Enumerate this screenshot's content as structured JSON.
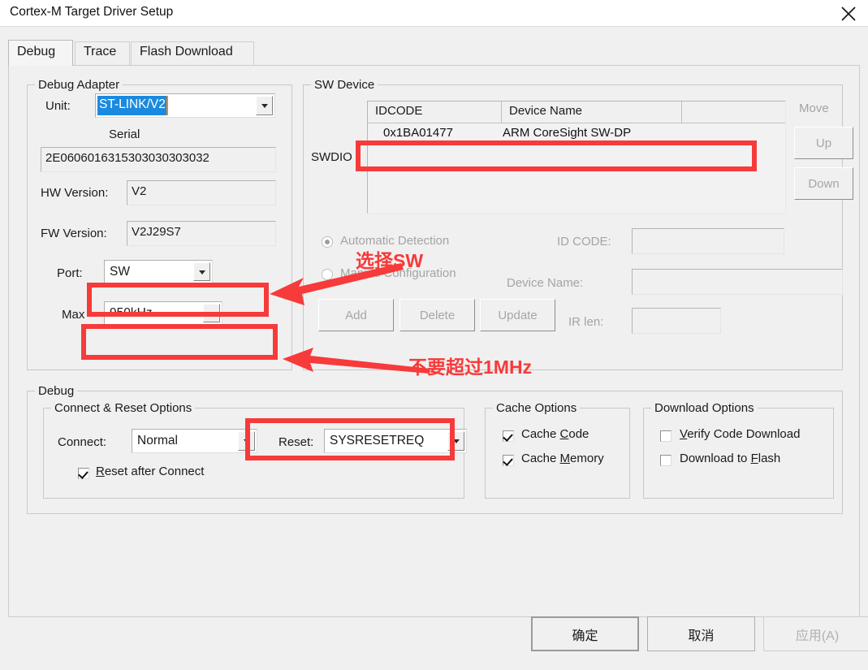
{
  "window": {
    "title": "Cortex-M Target Driver Setup",
    "close_icon": "close-icon"
  },
  "tabs": [
    {
      "label": "Debug",
      "active": true
    },
    {
      "label": "Trace",
      "active": false
    },
    {
      "label": "Flash Download",
      "active": false
    }
  ],
  "debug_adapter": {
    "legend": "Debug Adapter",
    "unit_label": "Unit:",
    "unit_value": "ST-LINK/V2",
    "serial_label": "Serial",
    "serial_value": "2E0606016315303030303032",
    "hw_version_label": "HW Version:",
    "hw_version_value": "V2",
    "fw_version_label": "FW Version:",
    "fw_version_value": "V2J29S7",
    "port_label": "Port:",
    "port_value": "SW",
    "max_label": "Max",
    "max_value": "950kHz"
  },
  "sw_device": {
    "legend": "SW Device",
    "swdio_label": "SWDIO",
    "columns": [
      "IDCODE",
      "Device Name",
      ""
    ],
    "rows": [
      {
        "idcode": "0x1BA01477",
        "device_name": "ARM CoreSight SW-DP"
      }
    ],
    "move_label": "Move",
    "up_label": "Up",
    "down_label": "Down",
    "auto_detection_label": "Automatic Detection",
    "manual_config_label": "Manual Configuration",
    "add_label": "Add",
    "delete_label": "Delete",
    "update_label": "Update",
    "id_code_label": "ID CODE:",
    "id_code_value": "",
    "device_name_label": "Device Name:",
    "device_name_value": "",
    "ir_len_label": "IR len:",
    "ir_len_value": ""
  },
  "debug": {
    "legend": "Debug",
    "connect_reset": {
      "legend": "Connect & Reset Options",
      "connect_label": "Connect:",
      "connect_value": "Normal",
      "reset_label": "Reset:",
      "reset_value": "SYSRESETREQ",
      "reset_after_connect_label": "Reset after Connect",
      "reset_after_connect_checked": true
    },
    "cache_options": {
      "legend": "Cache Options",
      "cache_code_label": "Cache Code",
      "cache_code_checked": true,
      "cache_memory_label": "Cache Memory",
      "cache_memory_checked": true
    },
    "download_options": {
      "legend": "Download Options",
      "verify_code_label": "Verify Code Download",
      "verify_code_checked": false,
      "download_flash_label": "Download to Flash",
      "download_flash_checked": false
    }
  },
  "footer": {
    "ok_label": "确定",
    "cancel_label": "取消",
    "apply_label": "应用(A)"
  },
  "annotations": {
    "accent_color": "#f73a3a",
    "select_sw_text": "选择SW",
    "max_1mhz_text": "不要超过1MHz"
  }
}
